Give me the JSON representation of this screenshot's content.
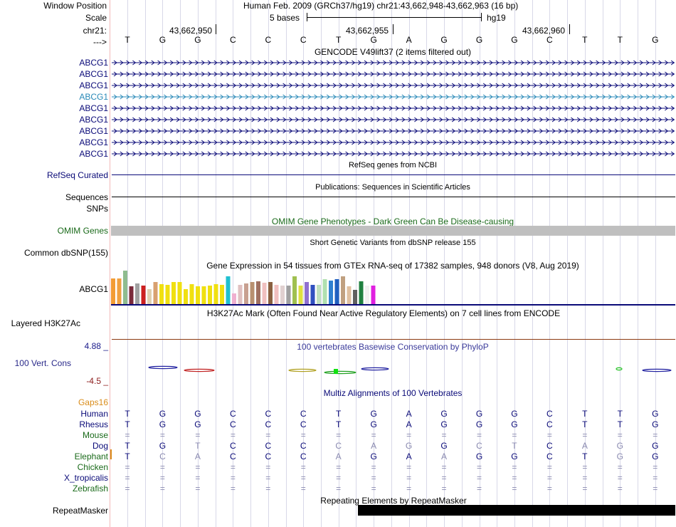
{
  "header": {
    "window_position_label": "Window Position",
    "scale_label": "Scale",
    "chrom_label": "chr21:",
    "strand_label": "--->",
    "window_position_value": "Human Feb. 2009 (GRCh37/hg19)   chr21:43,662,948-43,662,963 (16 bp)",
    "scale_value": "5 bases",
    "assembly": "hg19",
    "positions": [
      "43,662,950",
      "43,662,955",
      "43,662,960"
    ]
  },
  "bases": [
    "T",
    "G",
    "G",
    "C",
    "C",
    "C",
    "T",
    "G",
    "A",
    "G",
    "G",
    "G",
    "C",
    "T",
    "T",
    "G"
  ],
  "tracks": {
    "gencode": {
      "title": "GENCODE V49lift37 (2 items filtered out)",
      "items": [
        "ABCG1",
        "ABCG1",
        "ABCG1",
        "ABCG1",
        "ABCG1",
        "ABCG1",
        "ABCG1",
        "ABCG1",
        "ABCG1"
      ],
      "highlight_color": "#2a8ab8",
      "color": "#0a0a78"
    },
    "refseq": {
      "title": "RefSeq genes from NCBI",
      "label": "RefSeq Curated"
    },
    "pubs": {
      "title": "Publications: Sequences in Scientific Articles",
      "label": "Sequences"
    },
    "snps_label": "SNPs",
    "omim": {
      "title": "OMIM Gene Phenotypes - Dark Green Can Be Disease-causing",
      "label": "OMIM Genes",
      "bar_color": "#bfbfbf"
    },
    "dbsnp": {
      "title": "Short Genetic Variants from dbSNP release 155",
      "label": "Common dbSNP(155)"
    },
    "gtex": {
      "title": "Gene Expression in 54 tissues from GTEx RNA-seq of 17382 samples, 948 donors (V8, Aug 2019)",
      "label": "ABCG1"
    },
    "h3k27ac": {
      "title": "H3K27Ac Mark (Often Found Near Active Regulatory Elements) on 7 cell lines from ENCODE",
      "label": "Layered H3K27Ac"
    },
    "phylop": {
      "title": "100 vertebrates Basewise Conservation by PhyloP",
      "label": "100 Vert. Cons",
      "max": "4.88 _",
      "min": "-4.5 _"
    },
    "multiz": {
      "title": "Multiz Alignments of 100 Vertebrates",
      "gaps_label": "Gaps16",
      "species": [
        {
          "name": "Human",
          "bases": [
            "T",
            "G",
            "G",
            "C",
            "C",
            "C",
            "T",
            "G",
            "A",
            "G",
            "G",
            "G",
            "C",
            "T",
            "T",
            "G"
          ]
        },
        {
          "name": "Rhesus",
          "bases": [
            "T",
            "G",
            "G",
            "C",
            "C",
            "C",
            "T",
            "G",
            "A",
            "G",
            "G",
            "G",
            "C",
            "T",
            "T",
            "G"
          ]
        },
        {
          "name": "Mouse",
          "bases": [
            "=",
            "=",
            "=",
            "=",
            "=",
            "=",
            "=",
            "=",
            "=",
            "=",
            "=",
            "=",
            "=",
            "=",
            "=",
            "="
          ]
        },
        {
          "name": "Dog",
          "bases": [
            "T",
            "G",
            "T",
            "C",
            "C",
            "C",
            "C",
            "A",
            "G",
            "G",
            "C",
            "T",
            "C",
            "A",
            "G",
            "G"
          ]
        },
        {
          "name": "Elephant",
          "bases": [
            "T",
            "C",
            "A",
            "C",
            "C",
            "C",
            "A",
            "G",
            "A",
            "A",
            "G",
            "G",
            "C",
            "T",
            "G",
            "G"
          ]
        },
        {
          "name": "Chicken",
          "bases": [
            "=",
            "=",
            "=",
            "=",
            "=",
            "=",
            "=",
            "=",
            "=",
            "=",
            "=",
            "=",
            "=",
            "=",
            "=",
            "="
          ]
        },
        {
          "name": "X_tropicalis",
          "bases": [
            "=",
            "=",
            "=",
            "=",
            "=",
            "=",
            "=",
            "=",
            "=",
            "=",
            "=",
            "=",
            "=",
            "=",
            "=",
            "="
          ]
        },
        {
          "name": "Zebrafish",
          "bases": [
            "=",
            "=",
            "=",
            "=",
            "=",
            "=",
            "=",
            "=",
            "=",
            "=",
            "=",
            "=",
            "=",
            "=",
            "=",
            "="
          ]
        }
      ]
    },
    "repeatmasker": {
      "title": "Repeating Elements by RepeatMasker",
      "label": "RepeatMasker"
    }
  },
  "colors": {
    "navy": "#0a0a78",
    "green": "#1a6a1a",
    "orange": "#d98c1a",
    "grid": "#d8d8e8",
    "separator": "#f3b9b9",
    "h3k27ac_line": "#8b3a10",
    "phylop_max": "#1a1a8a",
    "phylop_min": "#8b1a1a"
  }
}
